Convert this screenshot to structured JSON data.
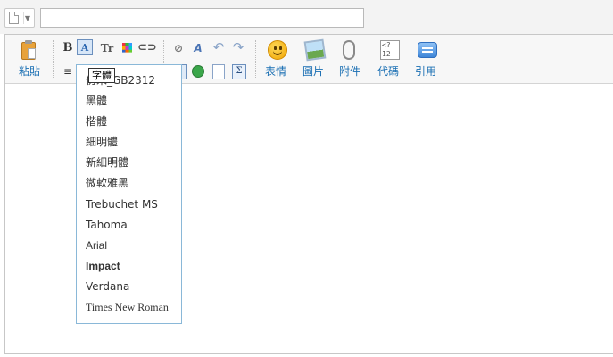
{
  "header": {
    "title_input_value": "",
    "title_input_placeholder": ""
  },
  "toolbar": {
    "paste_label": "粘貼",
    "bold_label": "B",
    "font_button_glyph": "A",
    "text_size_glyph": "Tr",
    "emoticon_label": "表情",
    "image_label": "圖片",
    "attachment_label": "附件",
    "code_label": "代碼",
    "quote_label": "引用",
    "icons": {
      "paste": "clipboard-icon",
      "font": "font-family-icon",
      "size": "text-size-icon",
      "color": "color-grid-icon",
      "link": "link-icon",
      "unlink": "unlink-icon",
      "remove_format": "remove-format-icon",
      "undo": "undo-icon",
      "redo": "redo-icon",
      "emoticon": "smiley-icon",
      "image": "picture-icon",
      "attachment": "paperclip-icon",
      "code": "code-icon",
      "quote": "speech-bubble-icon"
    }
  },
  "font_menu": {
    "tooltip": "字體",
    "items": [
      {
        "label": "仿宋_GB2312"
      },
      {
        "label": "黑體"
      },
      {
        "label": "楷體"
      },
      {
        "label": "細明體"
      },
      {
        "label": "新細明體"
      },
      {
        "label": "微軟雅黑"
      },
      {
        "label": "Trebuchet MS"
      },
      {
        "label": "Tahoma"
      },
      {
        "label": "Arial"
      },
      {
        "label": "Impact"
      },
      {
        "label": "Verdana"
      },
      {
        "label": "Times New Roman"
      }
    ]
  },
  "colors": {
    "accent": "#1a6fb3",
    "dropdown_border": "#8ab8d8",
    "toolbar_bg": "#f7f7f7"
  }
}
